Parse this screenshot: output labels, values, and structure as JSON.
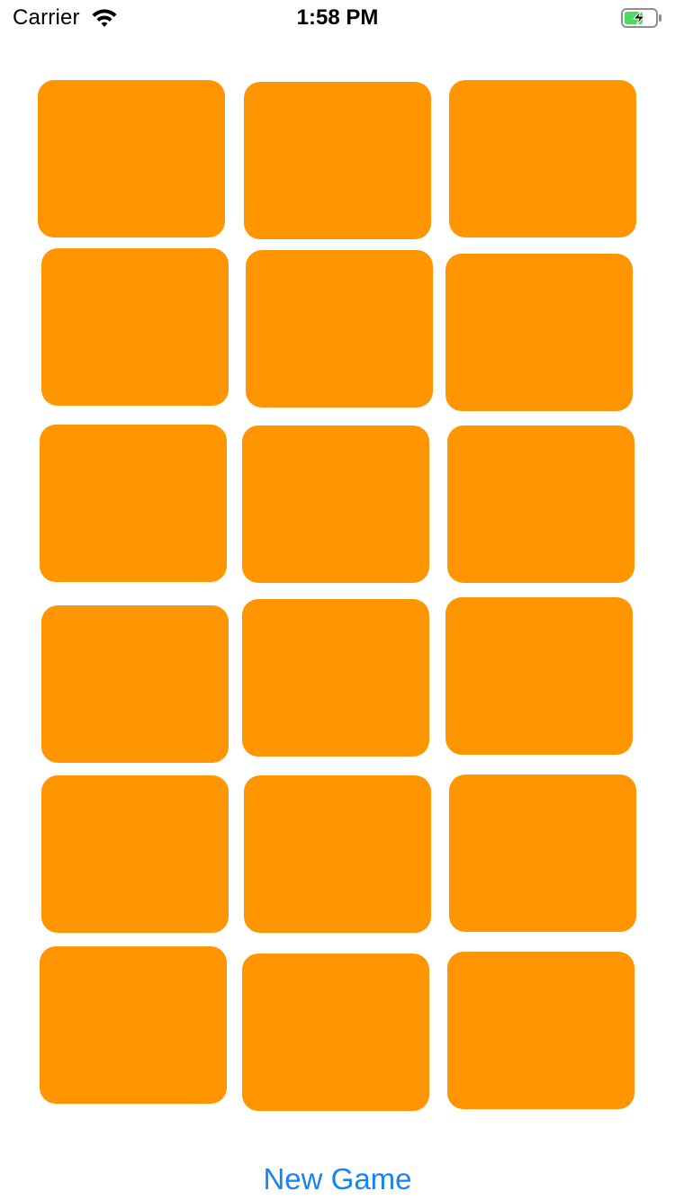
{
  "status_bar": {
    "carrier": "Carrier",
    "time": "1:58 PM",
    "wifi_icon": "wifi-icon",
    "battery_icon": "battery-charging-icon",
    "battery_color": "#4cd964"
  },
  "board": {
    "card_color": "#ff9500",
    "rows": 6,
    "columns": 3,
    "cards_face_down": 18
  },
  "new_game": {
    "label": "New Game",
    "color": "#1a82f7"
  }
}
